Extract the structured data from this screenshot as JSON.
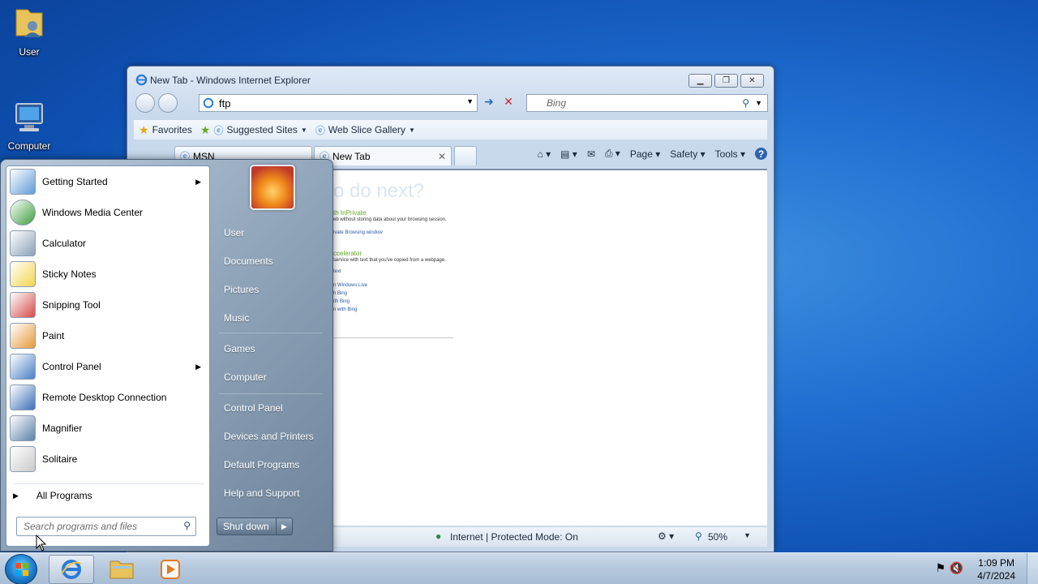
{
  "desktop": {
    "icons": [
      {
        "label": "User",
        "icon": "user-folder-icon"
      },
      {
        "label": "Computer",
        "icon": "computer-icon"
      }
    ]
  },
  "ie": {
    "title": "New Tab - Windows Internet Explorer",
    "address": "ftp",
    "search_placeholder": "Bing",
    "favorites_label": "Favorites",
    "suggested_sites": "Suggested Sites",
    "web_slice_gallery": "Web Slice Gallery",
    "tabs": [
      {
        "label": "MSN"
      },
      {
        "label": "New Tab"
      }
    ],
    "commands": {
      "page": "Page",
      "safety": "Safety",
      "tools": "Tools"
    },
    "content": {
      "heading": "o do next?",
      "inprivate_title": "th InPrivate",
      "inprivate_desc": "eb without storing data about your browsing session.",
      "inprivate_link": "ivate Browsing window",
      "accelerator_title": "ccelerator",
      "accelerator_desc": "service with text that you've copied from a webpage.",
      "accel_text": "text",
      "accel_items": [
        "n Windows Live",
        "h Bing",
        "ith Bing",
        "n with Bing"
      ]
    },
    "status": {
      "zone": "Internet | Protected Mode: On",
      "zoom": "50%"
    }
  },
  "start_menu": {
    "programs": [
      {
        "label": "Getting Started",
        "icon": "getting-started-icon",
        "submenu": true
      },
      {
        "label": "Windows Media Center",
        "icon": "media-center-icon",
        "submenu": false
      },
      {
        "label": "Calculator",
        "icon": "calculator-icon",
        "submenu": false
      },
      {
        "label": "Sticky Notes",
        "icon": "sticky-notes-icon",
        "submenu": false
      },
      {
        "label": "Snipping Tool",
        "icon": "snipping-tool-icon",
        "submenu": false
      },
      {
        "label": "Paint",
        "icon": "paint-icon",
        "submenu": false
      },
      {
        "label": "Control Panel",
        "icon": "control-panel-icon",
        "submenu": true
      },
      {
        "label": "Remote Desktop Connection",
        "icon": "remote-desktop-icon",
        "submenu": false
      },
      {
        "label": "Magnifier",
        "icon": "magnifier-icon",
        "submenu": false
      },
      {
        "label": "Solitaire",
        "icon": "solitaire-icon",
        "submenu": false
      }
    ],
    "all_programs": "All Programs",
    "search_placeholder": "Search programs and files",
    "right_items": [
      {
        "label": "User"
      },
      {
        "label": "Documents"
      },
      {
        "label": "Pictures"
      },
      {
        "label": "Music"
      },
      {
        "label": "Games"
      },
      {
        "label": "Computer"
      },
      {
        "label": "Control Panel"
      },
      {
        "label": "Devices and Printers"
      },
      {
        "label": "Default Programs"
      },
      {
        "label": "Help and Support"
      }
    ],
    "shutdown": "Shut down"
  },
  "taskbar": {
    "time": "1:09 PM",
    "date": "4/7/2024"
  }
}
